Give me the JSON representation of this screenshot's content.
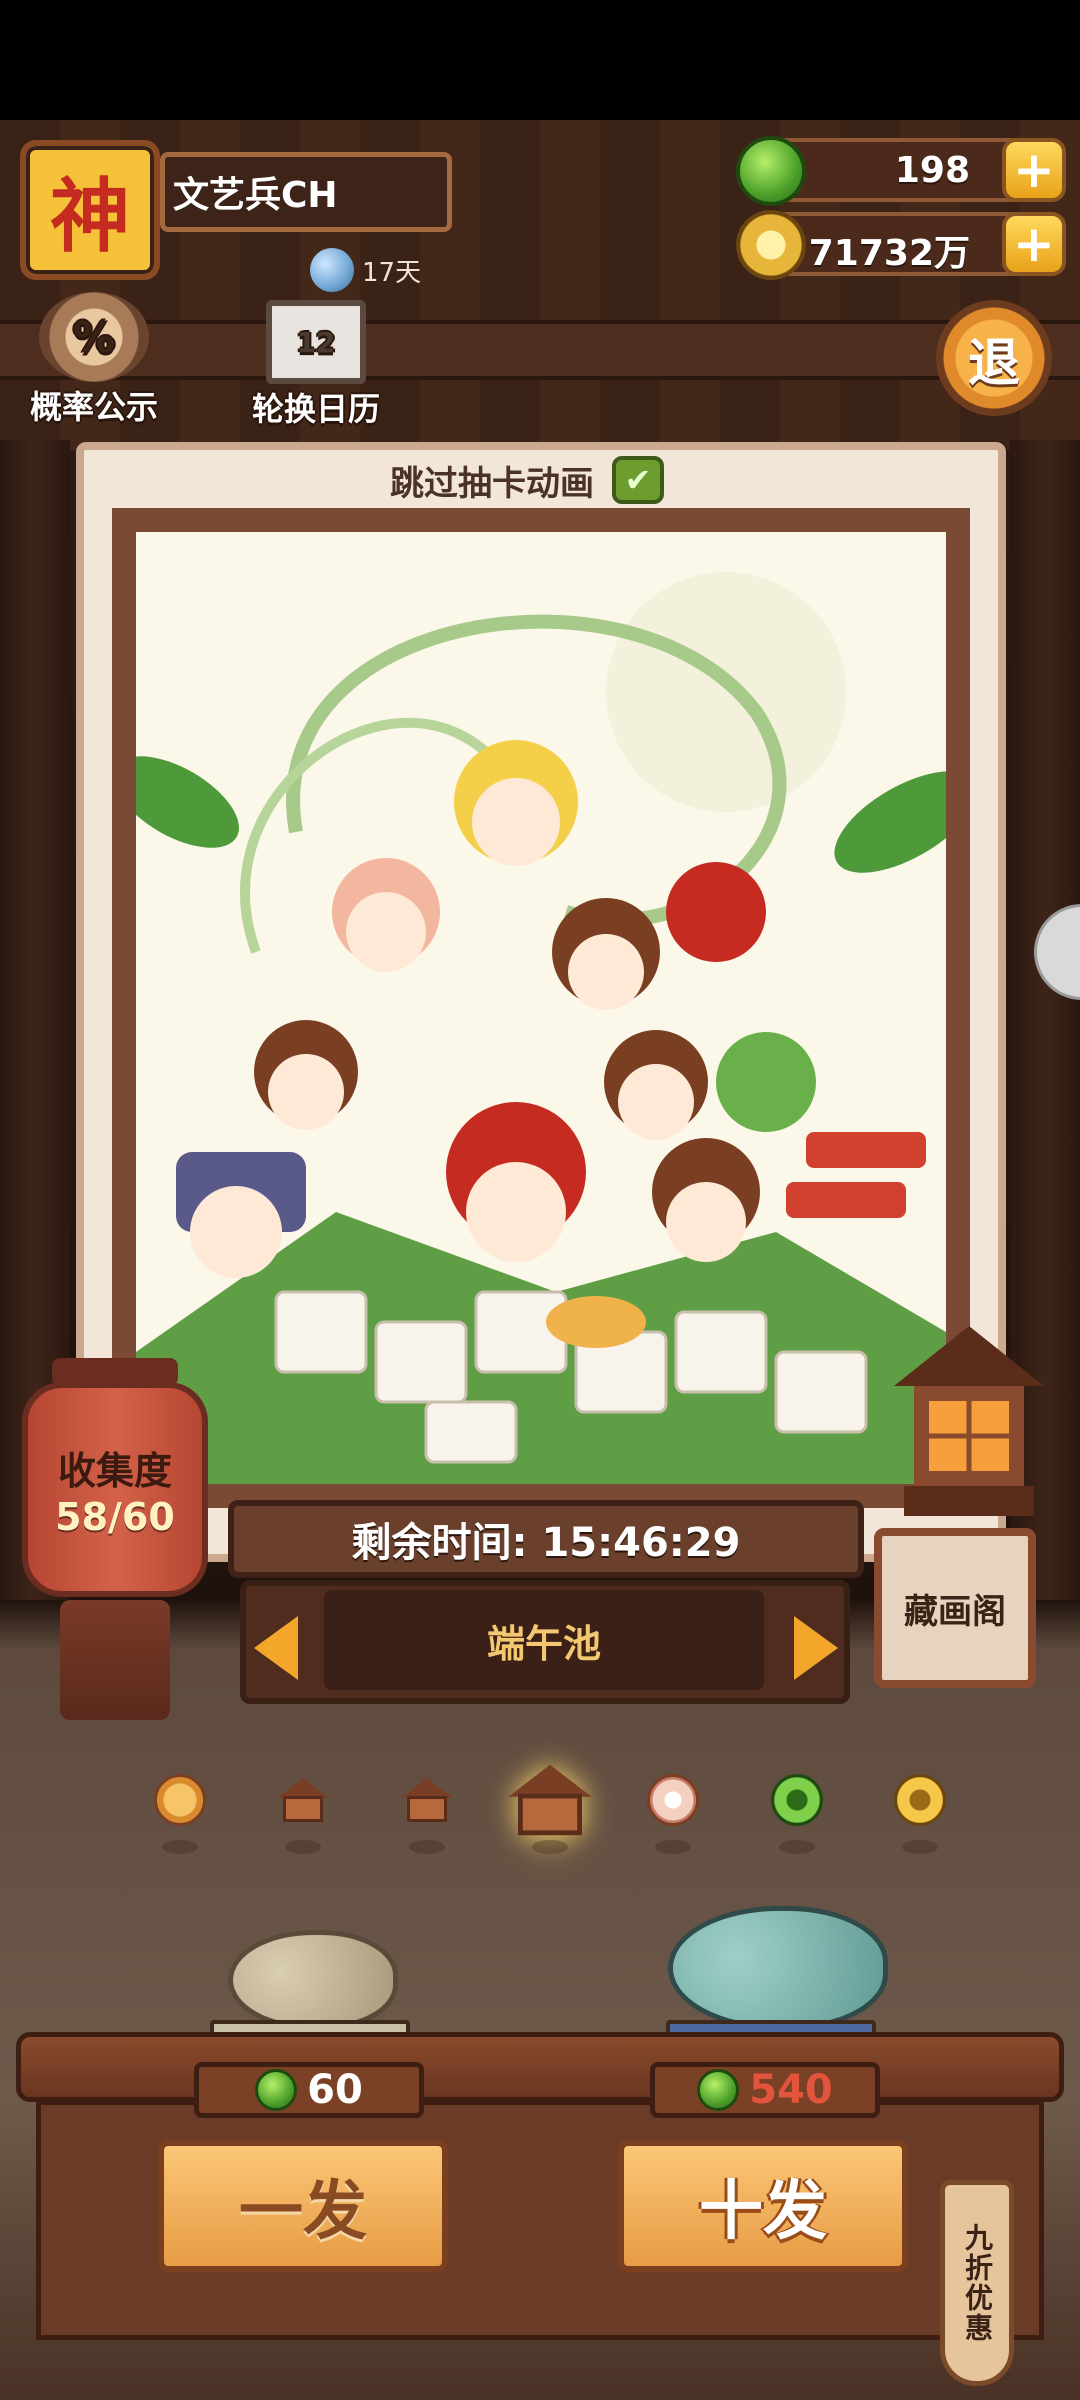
{
  "player": {
    "avatar_glyph": "神",
    "name": "文艺兵CH",
    "days": "17天"
  },
  "top_buttons": {
    "probability": "概率公示",
    "probability_icon": "%",
    "calendar": "轮换日历",
    "calendar_icon": "12"
  },
  "currency": {
    "jade": "198",
    "coins": "71732万"
  },
  "exit_label": "退",
  "skip_animation": {
    "label": "跳过抽卡动画",
    "checked_glyph": "✔"
  },
  "collection": {
    "label": "收集度",
    "value": "58/60"
  },
  "timer": {
    "label": "剩余时间: 15:46:29"
  },
  "pool": {
    "name": "端午池"
  },
  "gallery_label": "藏画阁",
  "draw": {
    "single": {
      "label": "一发",
      "cost": "60",
      "cost_color": "#ffffff"
    },
    "ten": {
      "label": "十发",
      "cost": "540",
      "cost_color": "#e2553c"
    },
    "discount_tag": "九折优惠"
  },
  "colors": {
    "accent": "#f2a72b",
    "wood": "#6a3b26",
    "jade_green": "#4ca02a"
  }
}
